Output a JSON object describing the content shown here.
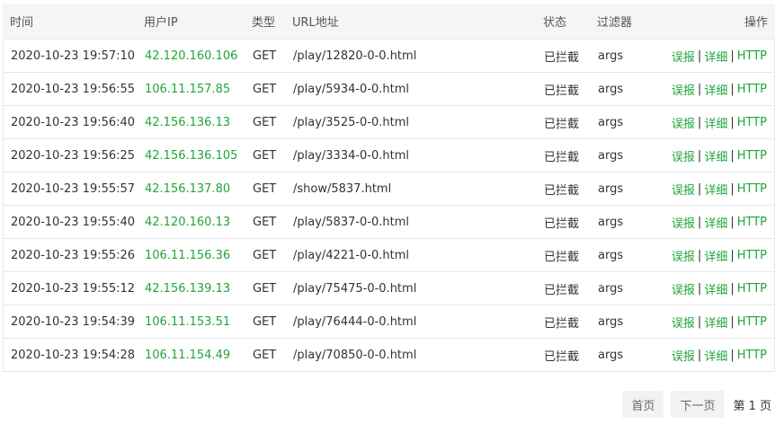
{
  "columns": {
    "time": "时间",
    "ip": "用户IP",
    "type": "类型",
    "url": "URL地址",
    "status": "状态",
    "filter": "过滤器",
    "ops": "操作"
  },
  "rows": [
    {
      "time": "2020-10-23 19:57:10",
      "ip": "42.120.160.106",
      "type": "GET",
      "url": "/play/12820-0-0.html",
      "status": "已拦截",
      "filter": "args"
    },
    {
      "time": "2020-10-23 19:56:55",
      "ip": "106.11.157.85",
      "type": "GET",
      "url": "/play/5934-0-0.html",
      "status": "已拦截",
      "filter": "args"
    },
    {
      "time": "2020-10-23 19:56:40",
      "ip": "42.156.136.13",
      "type": "GET",
      "url": "/play/3525-0-0.html",
      "status": "已拦截",
      "filter": "args"
    },
    {
      "time": "2020-10-23 19:56:25",
      "ip": "42.156.136.105",
      "type": "GET",
      "url": "/play/3334-0-0.html",
      "status": "已拦截",
      "filter": "args"
    },
    {
      "time": "2020-10-23 19:55:57",
      "ip": "42.156.137.80",
      "type": "GET",
      "url": "/show/5837.html",
      "status": "已拦截",
      "filter": "args"
    },
    {
      "time": "2020-10-23 19:55:40",
      "ip": "42.120.160.13",
      "type": "GET",
      "url": "/play/5837-0-0.html",
      "status": "已拦截",
      "filter": "args"
    },
    {
      "time": "2020-10-23 19:55:26",
      "ip": "106.11.156.36",
      "type": "GET",
      "url": "/play/4221-0-0.html",
      "status": "已拦截",
      "filter": "args"
    },
    {
      "time": "2020-10-23 19:55:12",
      "ip": "42.156.139.13",
      "type": "GET",
      "url": "/play/75475-0-0.html",
      "status": "已拦截",
      "filter": "args"
    },
    {
      "time": "2020-10-23 19:54:39",
      "ip": "106.11.153.51",
      "type": "GET",
      "url": "/play/76444-0-0.html",
      "status": "已拦截",
      "filter": "args"
    },
    {
      "time": "2020-10-23 19:54:28",
      "ip": "106.11.154.49",
      "type": "GET",
      "url": "/play/70850-0-0.html",
      "status": "已拦截",
      "filter": "args"
    }
  ],
  "actions": {
    "report": "误报",
    "detail": "详细",
    "http": "HTTP",
    "separator": "|"
  },
  "pager": {
    "first": "首页",
    "next": "下一页",
    "info": "第 1 页"
  },
  "colors": {
    "accent_green": "#20a53a",
    "header_bg": "#f5f5f5",
    "border": "#e6e6e6"
  }
}
